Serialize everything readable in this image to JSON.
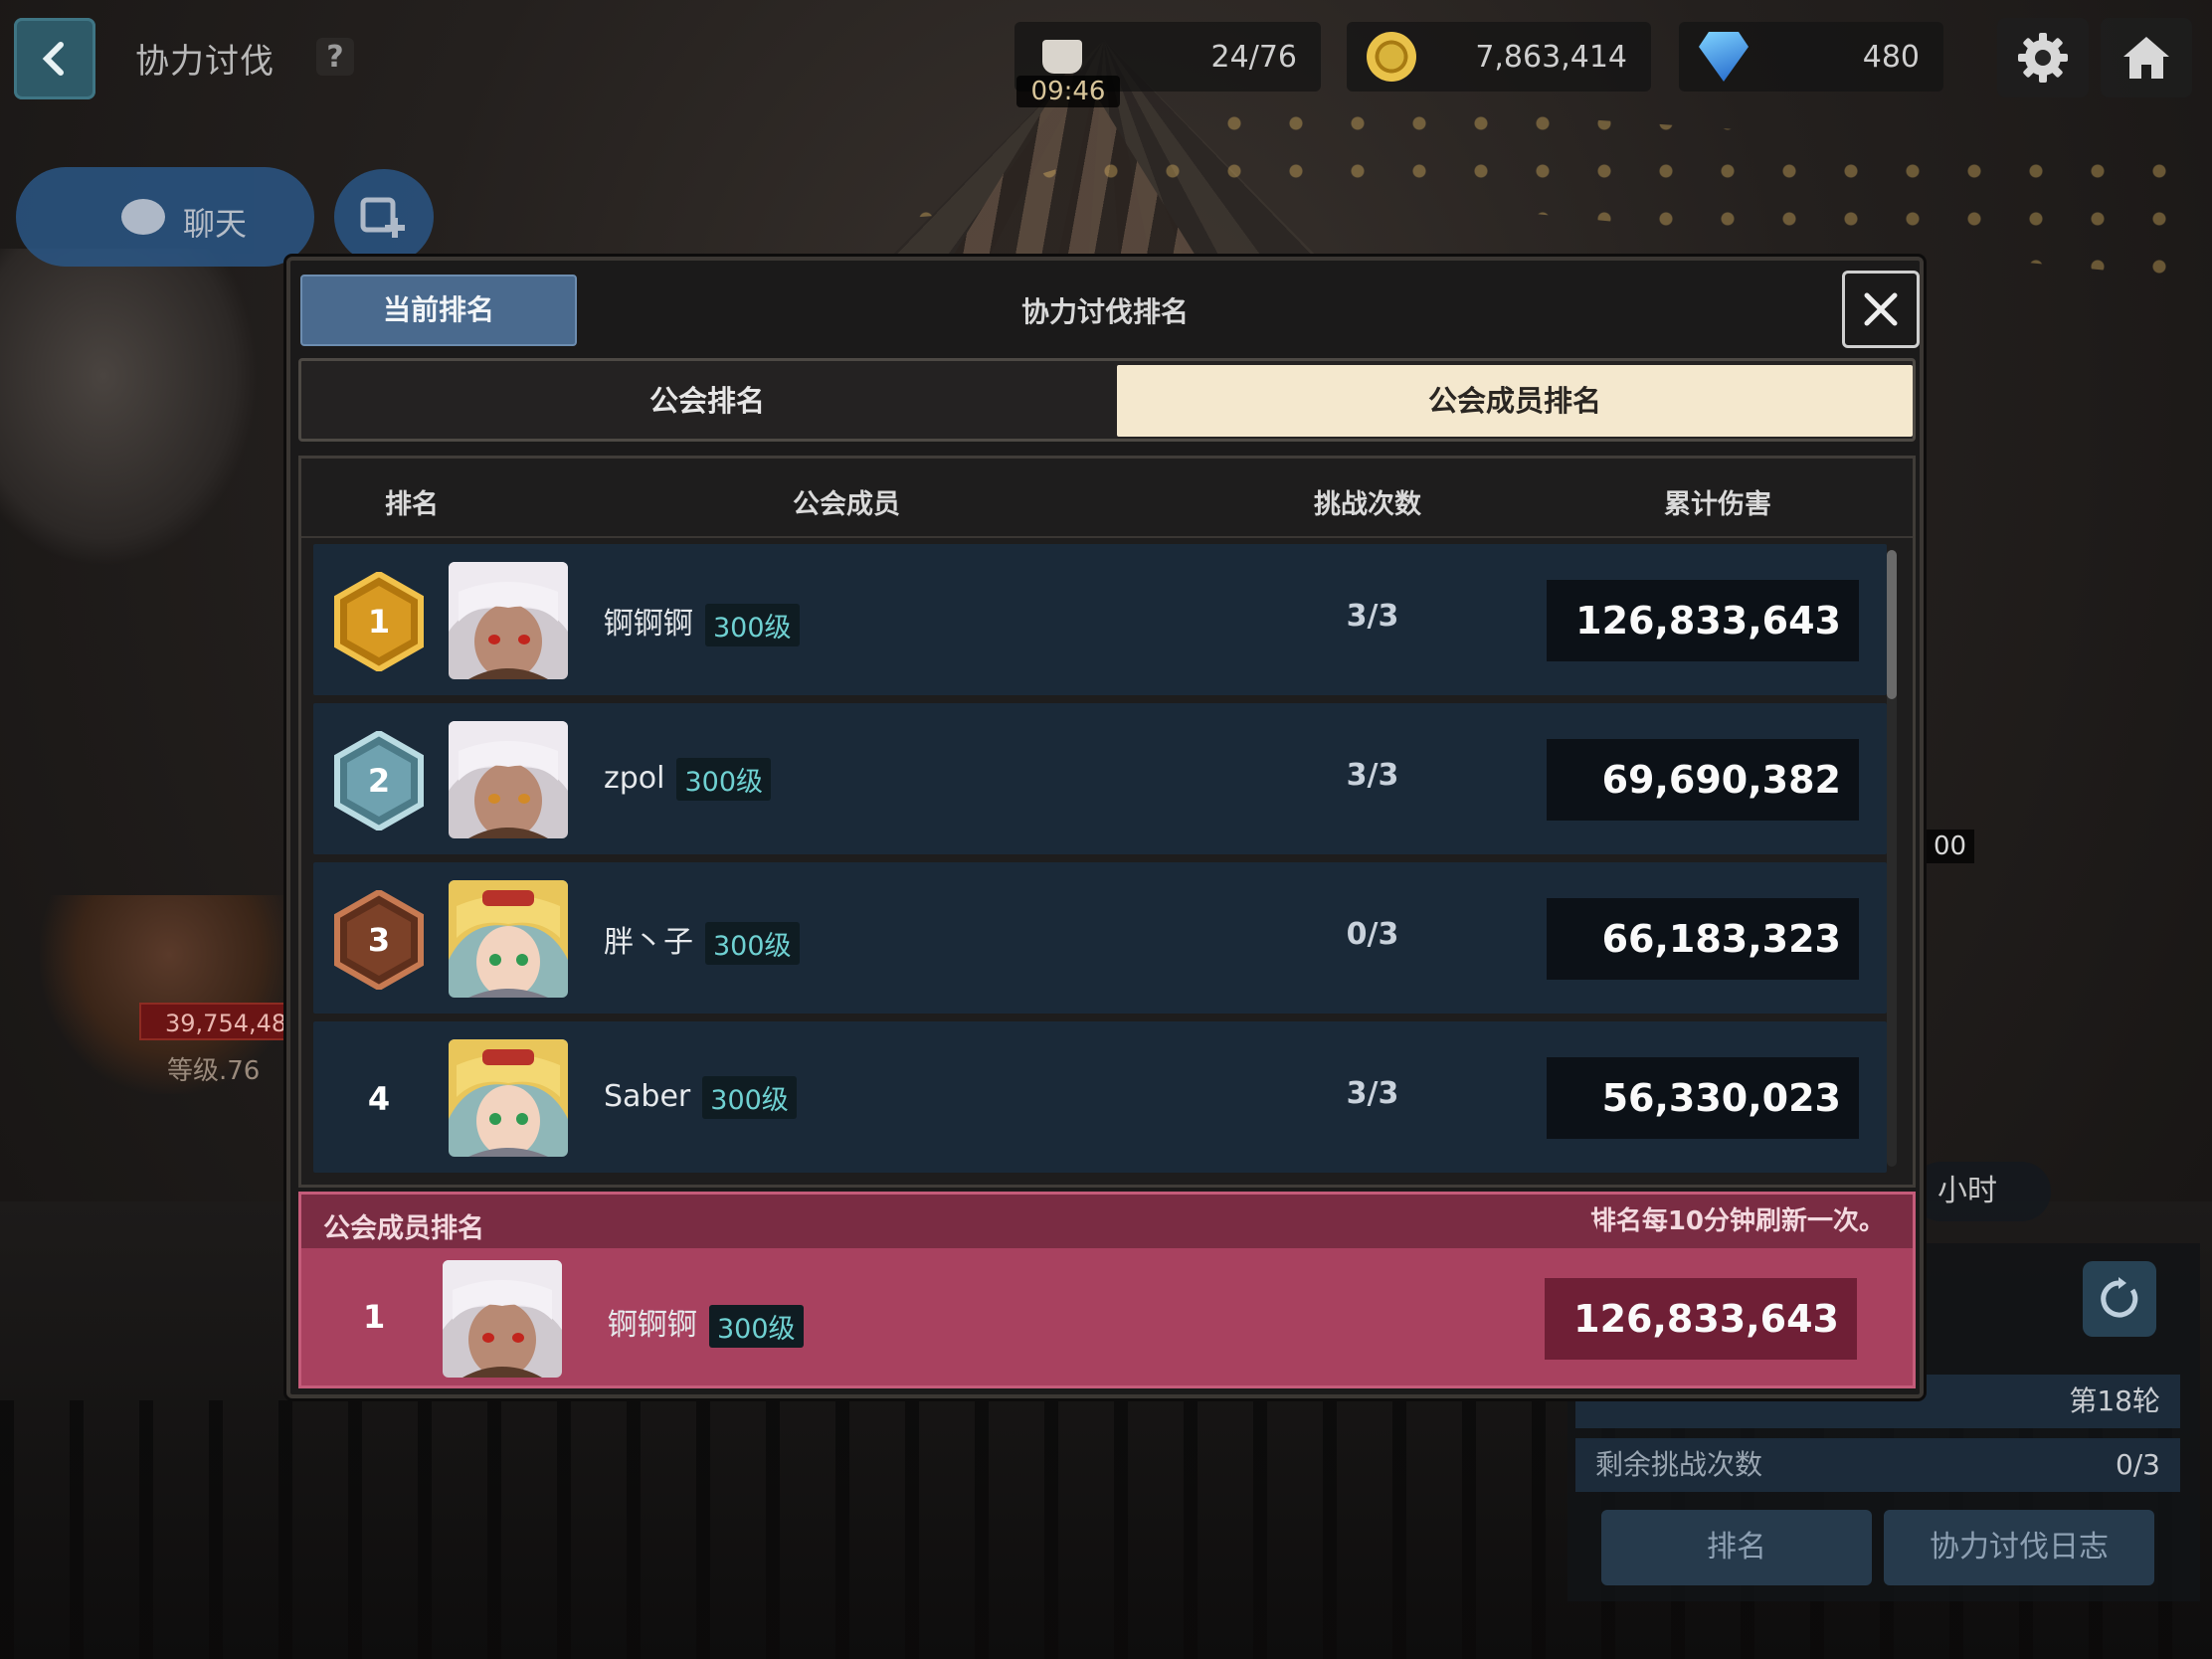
{
  "header": {
    "screen_title": "协力讨伐",
    "help_label": "?",
    "stamina": "24/76",
    "stamina_timer": "09:46",
    "gold": "7,863,414",
    "gems": "480"
  },
  "chat": {
    "label": "聊天"
  },
  "background_widgets": {
    "boss_hp": "39,754,48",
    "boss_level": "等级.76",
    "side_num": "00",
    "hours": "小时",
    "round_value": "第18轮",
    "remaining_label": "剩余挑战次数",
    "remaining_value": "0/3",
    "btn_ranking": "排名",
    "btn_log": "协力讨伐日志"
  },
  "modal": {
    "current_tab": "当前排名",
    "title": "协力讨伐排名",
    "tabs": {
      "guild": "公会排名",
      "members": "公会成员排名"
    },
    "columns": {
      "rank": "排名",
      "member": "公会成员",
      "challenges": "挑战次数",
      "damage": "累计伤害"
    },
    "rows": [
      {
        "rank": "1",
        "name": "锕锕锕",
        "level": "300级",
        "attempts": "3/3",
        "damage": "126,833,643",
        "avatar": "white-hair"
      },
      {
        "rank": "2",
        "name": "zpol",
        "level": "300级",
        "attempts": "3/3",
        "damage": "69,690,382",
        "avatar": "white-hair"
      },
      {
        "rank": "3",
        "name": "胖丶子",
        "level": "300级",
        "attempts": "0/3",
        "damage": "66,183,323",
        "avatar": "blonde"
      },
      {
        "rank": "4",
        "name": "Saber",
        "level": "300级",
        "attempts": "3/3",
        "damage": "56,330,023",
        "avatar": "blonde"
      }
    ],
    "my_rank": {
      "label": "公会成员排名",
      "note": "排名每10分钟刷新一次。",
      "rank": "1",
      "name": "锕锕锕",
      "level": "300级",
      "damage": "126,833,643"
    },
    "colors": {
      "gold": "#d99a22",
      "silver": "#7fb6c4",
      "bronze": "#8a4a2c",
      "highlight": "#a8415f"
    }
  }
}
